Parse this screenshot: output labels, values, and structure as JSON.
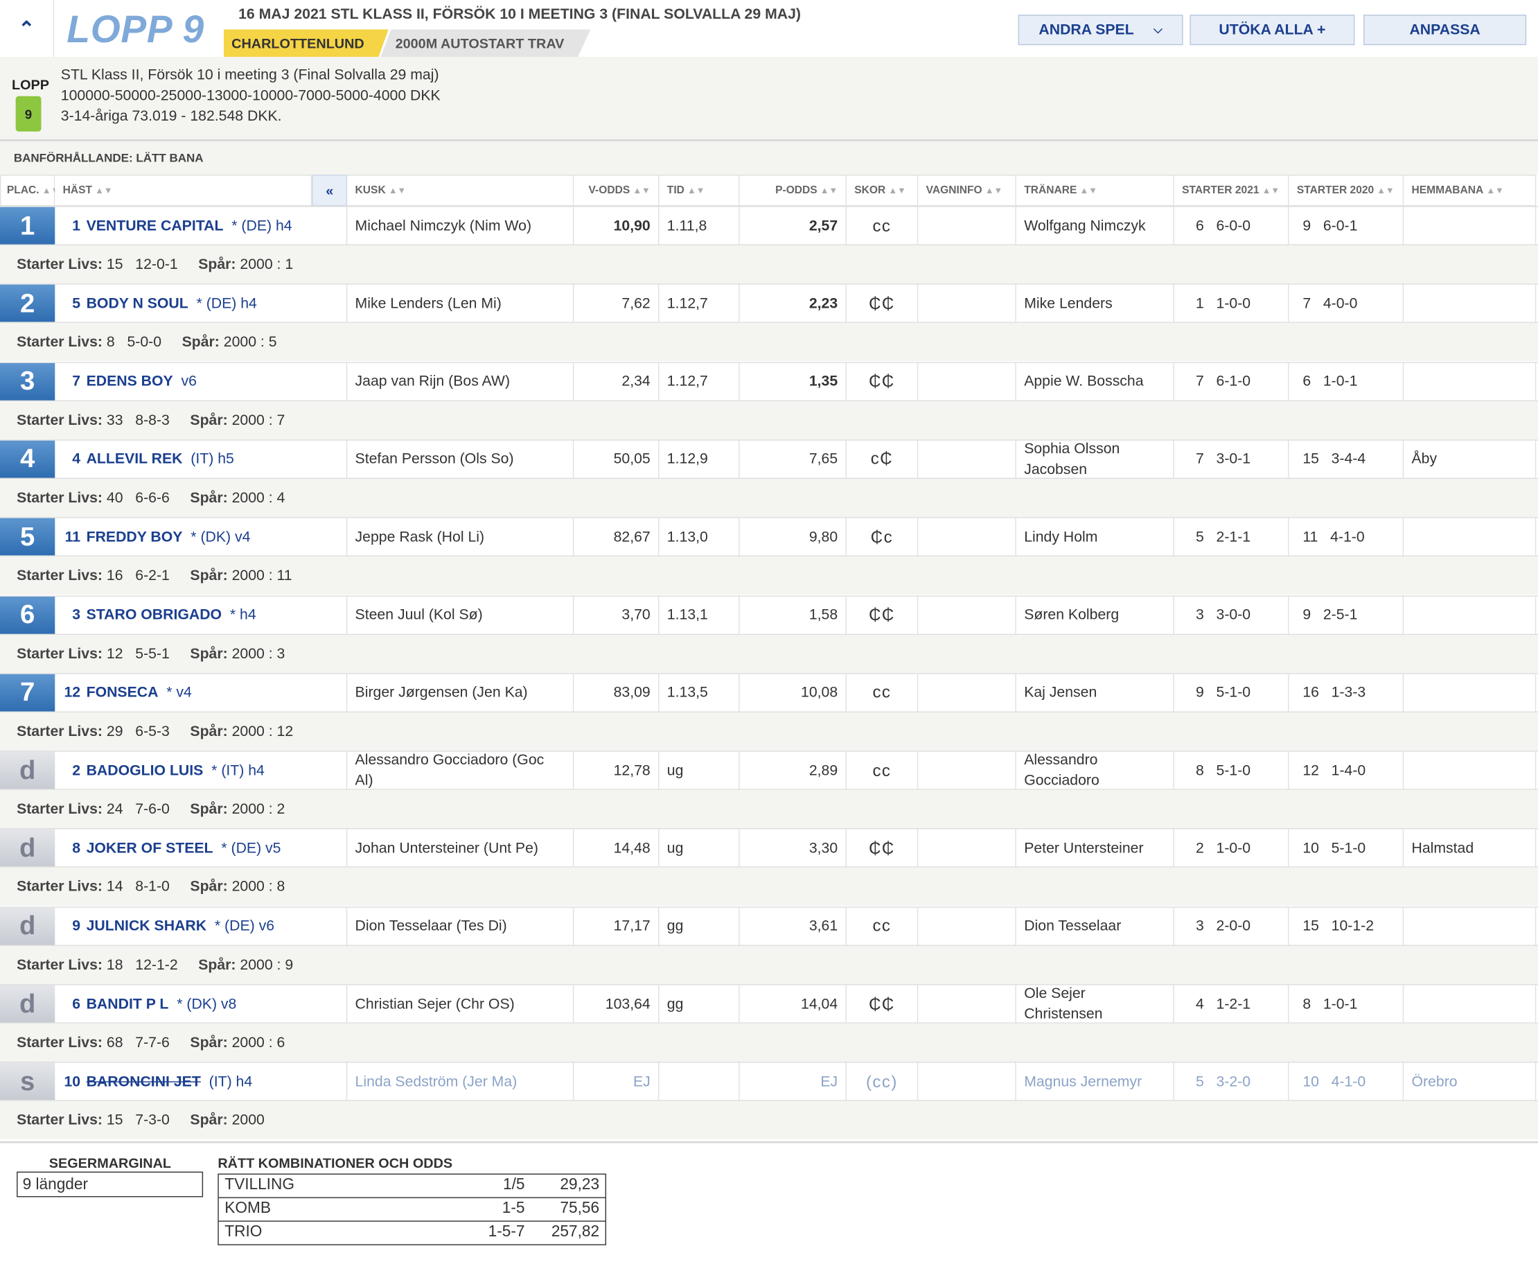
{
  "race": {
    "lopp_title": "LOPP 9",
    "headline": "16 MAJ 2021 STL KLASS II, FÖRSÖK 10 I MEETING 3 (FINAL SOLVALLA 29 MAJ)",
    "track": "CHARLOTTENLUND",
    "distance": "2000M AUTOSTART TRAV",
    "lopp_label": "LOPP",
    "lopp_number": "9",
    "info1": "STL Klass II, Försök 10 i meeting 3 (Final Solvalla 29 maj)",
    "info2": "100000-50000-25000-13000-10000-7000-5000-4000 DKK",
    "info3": "3-14-åriga 73.019 - 182.548 DKK.",
    "condition": "BANFÖRHÅLLANDE: LÄTT BANA"
  },
  "toolbar": {
    "andra_spel": "ANDRA SPEL",
    "utoka_alla": "UTÖKA ALLA +",
    "anpassa": "ANPASSA"
  },
  "columns": {
    "plac": "PLAC.",
    "hast": "HÄST",
    "collapse": "«",
    "kusk": "KUSK",
    "vodds": "V-ODDS",
    "tid": "TID",
    "podds": "P-ODDS",
    "skor": "SKOR",
    "vagninfo": "VAGNINFO",
    "tranare": "TRÄNARE",
    "starter2021": "STARTER 2021",
    "starter2020": "STARTER 2020",
    "hemmabana": "HEMMABANA"
  },
  "labels": {
    "starter_livs": "Starter Livs:",
    "spar": "Spår:"
  },
  "rows": [
    {
      "place": "1",
      "num": "1",
      "name": "VENTURE CAPITAL",
      "extra": "* (DE)  h4",
      "kusk": "Michael Nimczyk (Nim Wo)",
      "vodds": "10,90",
      "tid": "1.11,8",
      "podds": "2,57",
      "skor": "ᴄᴄ",
      "tranare": "Wolfgang Nimczyk",
      "s21n": "6",
      "s21": "6-0-0",
      "s20n": "9",
      "s20": "6-0-1",
      "hemma": "",
      "livs_n": "15",
      "livs": "12-0-1",
      "spar": "2000 : 1"
    },
    {
      "place": "2",
      "num": "5",
      "name": "BODY N SOUL",
      "extra": "* (DE)  h4",
      "kusk": "Mike Lenders (Len Mi)",
      "vodds": "7,62",
      "tid": "1.12,7",
      "podds": "2,23",
      "skor": "₵₵",
      "tranare": "Mike Lenders",
      "s21n": "1",
      "s21": "1-0-0",
      "s20n": "7",
      "s20": "4-0-0",
      "hemma": "",
      "livs_n": "8",
      "livs": "5-0-0",
      "spar": "2000 : 5"
    },
    {
      "place": "3",
      "num": "7",
      "name": "EDENS BOY",
      "extra": "v6",
      "kusk": "Jaap van Rijn (Bos AW)",
      "vodds": "2,34",
      "tid": "1.12,7",
      "podds": "1,35",
      "skor": "₵₵",
      "tranare": "Appie W. Bosscha",
      "s21n": "7",
      "s21": "6-1-0",
      "s20n": "6",
      "s20": "1-0-1",
      "hemma": "",
      "livs_n": "33",
      "livs": "8-8-3",
      "spar": "2000 : 7"
    },
    {
      "place": "4",
      "num": "4",
      "name": "ALLEVIL REK",
      "extra": "(IT)  h5",
      "kusk": "Stefan Persson (Ols So)",
      "vodds": "50,05",
      "tid": "1.12,9",
      "podds": "7,65",
      "skor": "ᴄ₵",
      "tranare": "Sophia Olsson Jacobsen",
      "s21n": "7",
      "s21": "3-0-1",
      "s20n": "15",
      "s20": "3-4-4",
      "hemma": "Åby",
      "livs_n": "40",
      "livs": "6-6-6",
      "spar": "2000 : 4"
    },
    {
      "place": "5",
      "num": "11",
      "name": "FREDDY BOY",
      "extra": "* (DK)  v4",
      "kusk": "Jeppe Rask (Hol Li)",
      "vodds": "82,67",
      "tid": "1.13,0",
      "podds": "9,80",
      "skor": "₵ᴄ",
      "tranare": "Lindy Holm",
      "s21n": "5",
      "s21": "2-1-1",
      "s20n": "11",
      "s20": "4-1-0",
      "hemma": "",
      "livs_n": "16",
      "livs": "6-2-1",
      "spar": "2000 : 11"
    },
    {
      "place": "6",
      "num": "3",
      "name": "STARO OBRIGADO",
      "extra": "* h4",
      "kusk": "Steen Juul (Kol Sø)",
      "vodds": "3,70",
      "tid": "1.13,1",
      "podds": "1,58",
      "skor": "₵₵",
      "tranare": "Søren Kolberg",
      "s21n": "3",
      "s21": "3-0-0",
      "s20n": "9",
      "s20": "2-5-1",
      "hemma": "",
      "livs_n": "12",
      "livs": "5-5-1",
      "spar": "2000 : 3"
    },
    {
      "place": "7",
      "num": "12",
      "name": "FONSECA",
      "extra": "* v4",
      "kusk": "Birger Jørgensen (Jen Ka)",
      "vodds": "83,09",
      "tid": "1.13,5",
      "podds": "10,08",
      "skor": "ᴄᴄ",
      "tranare": "Kaj Jensen",
      "s21n": "9",
      "s21": "5-1-0",
      "s20n": "16",
      "s20": "1-3-3",
      "hemma": "",
      "livs_n": "29",
      "livs": "6-5-3",
      "spar": "2000 : 12"
    },
    {
      "place": "d",
      "num": "2",
      "name": "BADOGLIO LUIS",
      "extra": "* (IT)  h4",
      "kusk": "Alessandro Gocciadoro (Goc Al)",
      "vodds": "12,78",
      "tid": "ug",
      "podds": "2,89",
      "skor": "ᴄᴄ",
      "tranare": "Alessandro Gocciadoro",
      "s21n": "8",
      "s21": "5-1-0",
      "s20n": "12",
      "s20": "1-4-0",
      "hemma": "",
      "livs_n": "24",
      "livs": "7-6-0",
      "spar": "2000 : 2"
    },
    {
      "place": "d",
      "num": "8",
      "name": "JOKER OF STEEL",
      "extra": "* (DE)  v5",
      "kusk": "Johan Untersteiner (Unt Pe)",
      "vodds": "14,48",
      "tid": "ug",
      "podds": "3,30",
      "skor": "₵₵",
      "tranare": "Peter Untersteiner",
      "s21n": "2",
      "s21": "1-0-0",
      "s20n": "10",
      "s20": "5-1-0",
      "hemma": "Halmstad",
      "livs_n": "14",
      "livs": "8-1-0",
      "spar": "2000 : 8"
    },
    {
      "place": "d",
      "num": "9",
      "name": "JULNICK SHARK",
      "extra": "* (DE)  v6",
      "kusk": "Dion Tesselaar (Tes Di)",
      "vodds": "17,17",
      "tid": "gg",
      "podds": "3,61",
      "skor": "ᴄᴄ",
      "tranare": "Dion Tesselaar",
      "s21n": "3",
      "s21": "2-0-0",
      "s20n": "15",
      "s20": "10-1-2",
      "hemma": "",
      "livs_n": "18",
      "livs": "12-1-2",
      "spar": "2000 : 9"
    },
    {
      "place": "d",
      "num": "6",
      "name": "BANDIT P L",
      "extra": "* (DK)  v8",
      "kusk": "Christian Sejer (Chr OS)",
      "vodds": "103,64",
      "tid": "gg",
      "podds": "14,04",
      "skor": "₵₵",
      "tranare": "Ole Sejer Christensen",
      "s21n": "4",
      "s21": "1-2-1",
      "s20n": "8",
      "s20": "1-0-1",
      "hemma": "",
      "livs_n": "68",
      "livs": "7-7-6",
      "spar": "2000 : 6"
    },
    {
      "place": "s",
      "num": "10",
      "name": "BARONCINI JET",
      "extra": "(IT)  h4",
      "kusk": "Linda Sedström (Jer Ma)",
      "vodds": "EJ",
      "tid": "",
      "podds": "EJ",
      "skor": "(ᴄᴄ)",
      "tranare": "Magnus Jernemyr",
      "s21n": "5",
      "s21": "3-2-0",
      "s20n": "10",
      "s20": "4-1-0",
      "hemma": "Örebro",
      "livs_n": "15",
      "livs": "7-3-0",
      "spar": "2000",
      "scratched": true
    }
  ],
  "segermarginal": {
    "title": "SEGERMARGINAL",
    "value": "9 längder"
  },
  "kombinationer": {
    "title": "RÄTT KOMBINATIONER OCH ODDS",
    "rows": [
      {
        "name": "TVILLING",
        "comb": "1/5",
        "odds": "29,23"
      },
      {
        "name": "KOMB",
        "comb": "1-5",
        "odds": "75,56"
      },
      {
        "name": "TRIO",
        "comb": "1-5-7",
        "odds": "257,82"
      }
    ]
  }
}
